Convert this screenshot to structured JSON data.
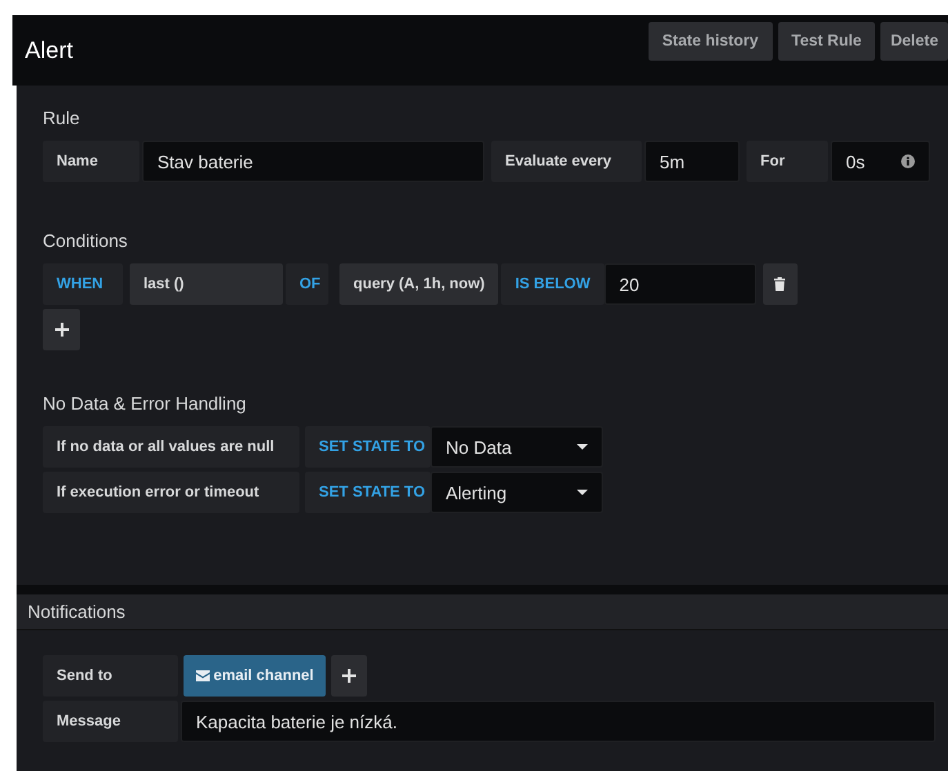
{
  "title": "Alert",
  "header_buttons": [
    "State history",
    "Test Rule",
    "Delete"
  ],
  "rule": {
    "heading": "Rule",
    "fields": [
      {
        "label": "Name",
        "value": "Stav baterie",
        "info": false
      },
      {
        "label": "Evaluate every",
        "value": "5m",
        "info": false
      },
      {
        "label": "For",
        "value": "0s",
        "info": true
      }
    ]
  },
  "conditions": {
    "heading": "Conditions",
    "rows": [
      {
        "when": "WHEN",
        "reducer": "last ()",
        "of": "OF",
        "query": "query (A, 1h, now)",
        "evaluator": "IS BELOW",
        "threshold": "20"
      }
    ]
  },
  "no_data": {
    "heading": "No Data & Error Handling",
    "rows": [
      {
        "label": "If no data or all values are null",
        "action": "SET STATE TO",
        "state": "No Data"
      },
      {
        "label": "If execution error or timeout",
        "action": "SET STATE TO",
        "state": "Alerting"
      }
    ]
  },
  "notifications": {
    "heading": "Notifications",
    "send_to_label": "Send to",
    "channels": [
      {
        "name": "email channel"
      }
    ],
    "message_label": "Message",
    "message": "Kapacita baterie je nízká."
  }
}
